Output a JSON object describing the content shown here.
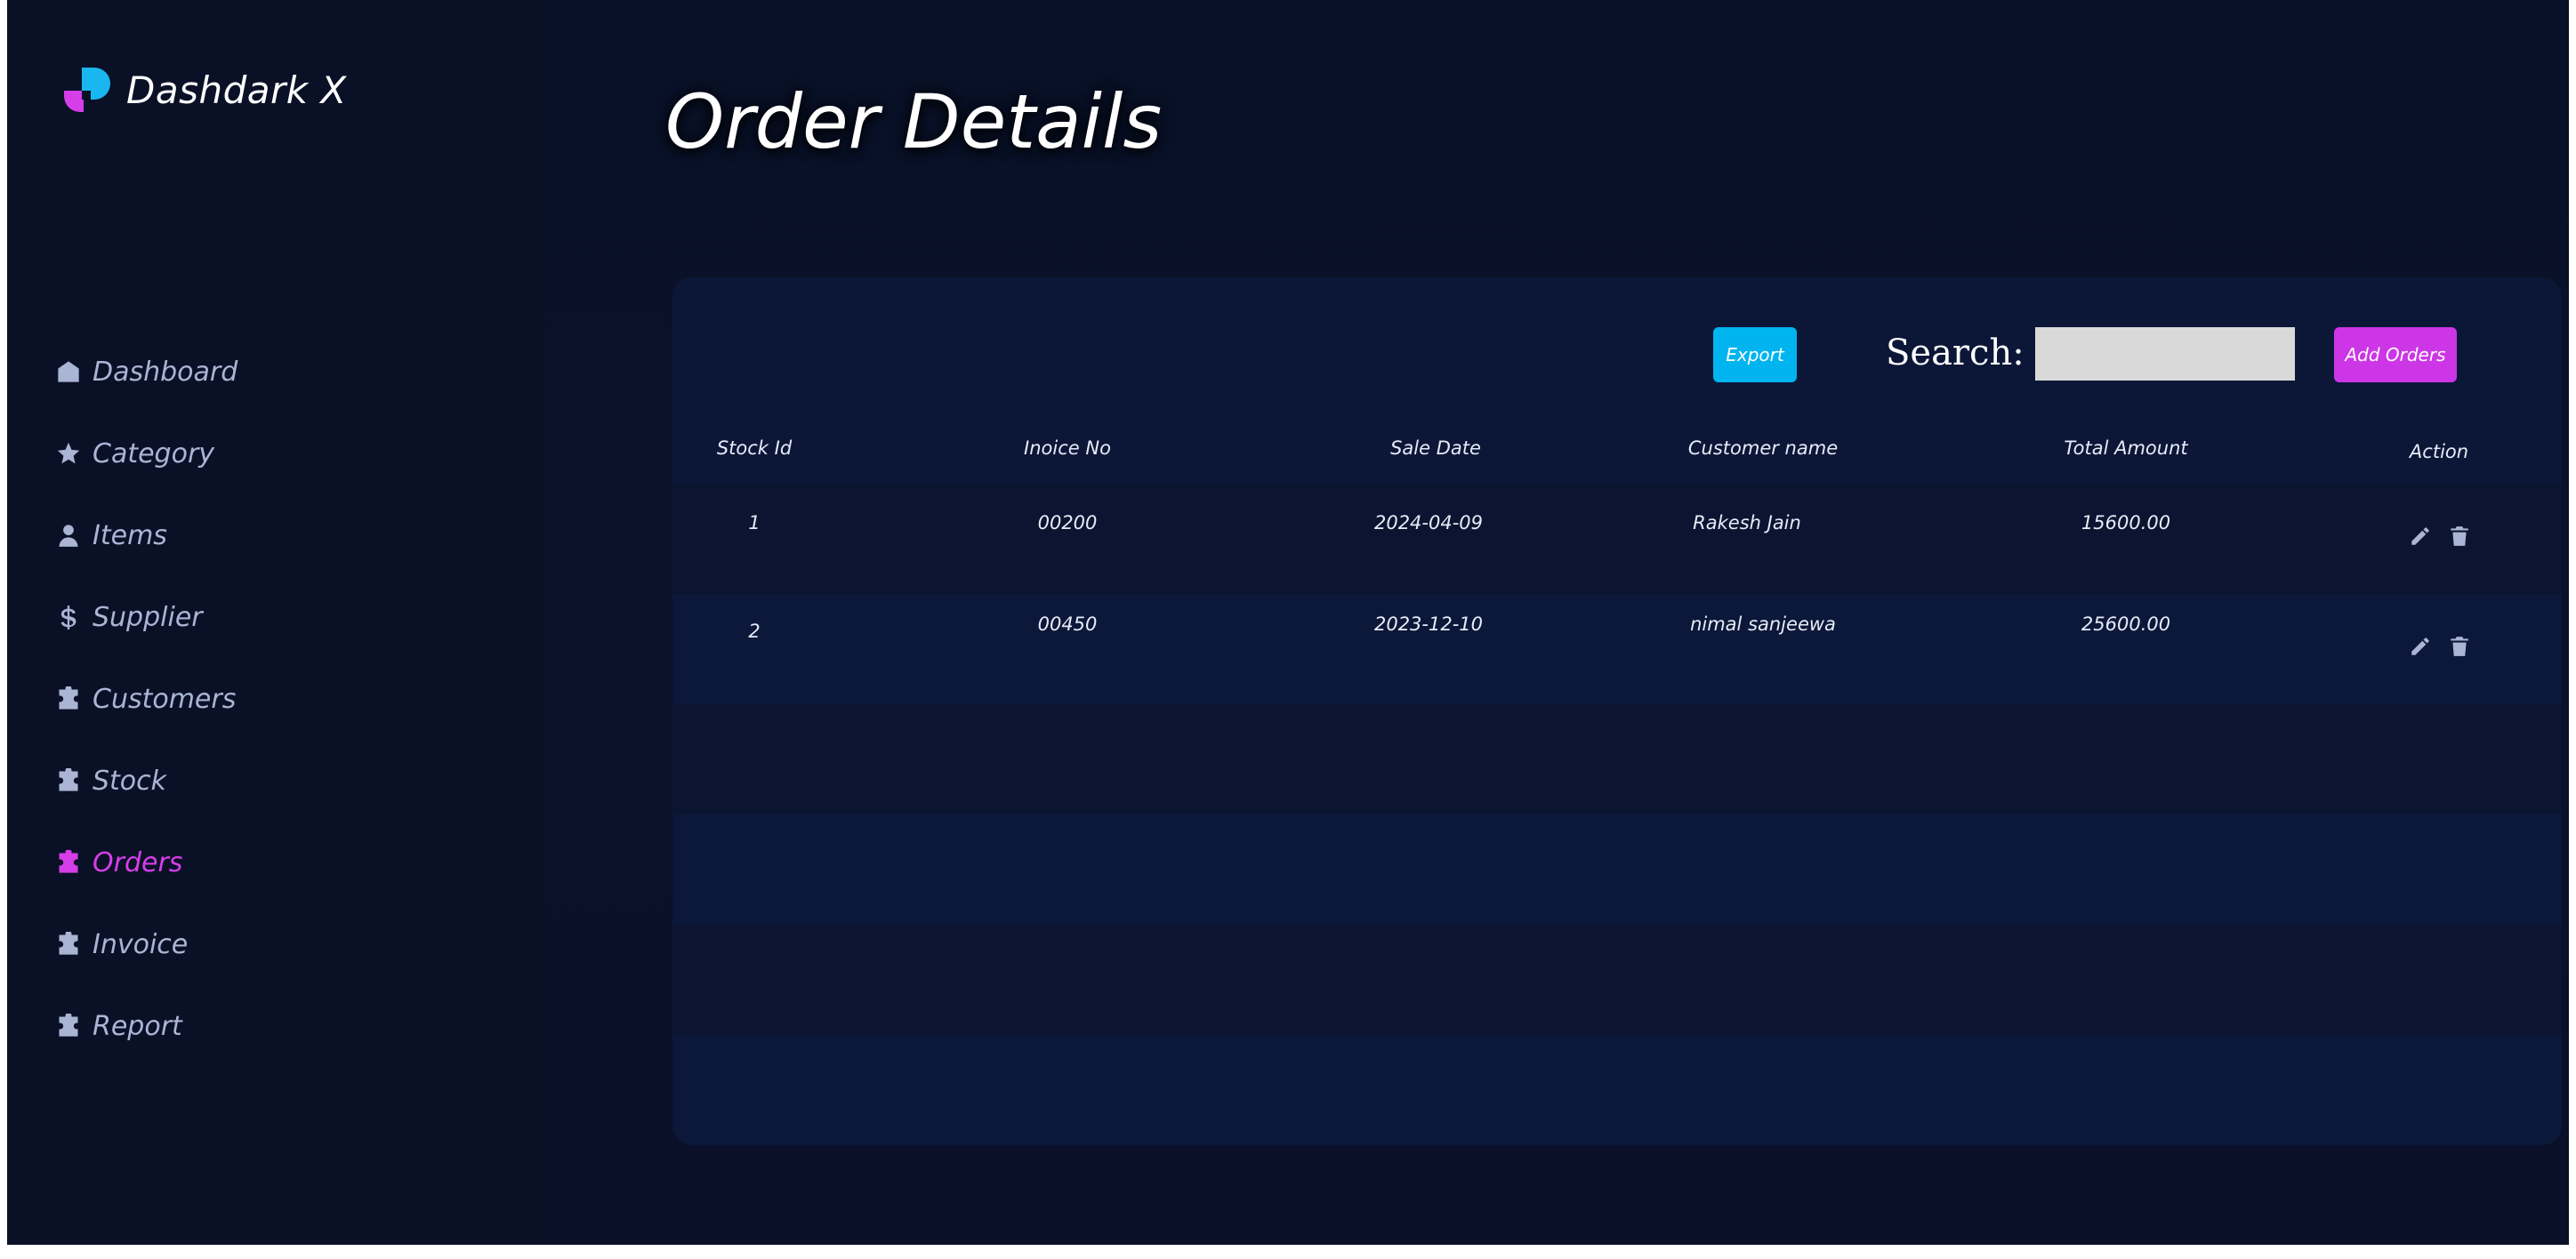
{
  "brand": {
    "name": "Dashdark X"
  },
  "sidebar": {
    "items": [
      {
        "label": "Dashboard",
        "icon": "home-icon"
      },
      {
        "label": "Category",
        "icon": "star-icon"
      },
      {
        "label": "Items",
        "icon": "user-icon"
      },
      {
        "label": "Supplier",
        "icon": "dollar-icon"
      },
      {
        "label": "Customers",
        "icon": "puzzle-icon"
      },
      {
        "label": "Stock",
        "icon": "puzzle-icon"
      },
      {
        "label": "Orders",
        "icon": "puzzle-icon",
        "active": true
      },
      {
        "label": "Invoice",
        "icon": "puzzle-icon"
      },
      {
        "label": "Report",
        "icon": "puzzle-icon"
      }
    ]
  },
  "page": {
    "title": "Order Details"
  },
  "toolbar": {
    "export_label": "Export",
    "search_label": "Search:",
    "search_value": "",
    "add_label": "Add Orders"
  },
  "table": {
    "columns": [
      "Stock Id",
      "Inoice No",
      "Sale Date",
      "Customer name",
      "Total Amount",
      "Action"
    ],
    "rows": [
      {
        "stock_id": "1",
        "invoice_no": "00200",
        "sale_date": "2024-04-09",
        "customer": "Rakesh Jain",
        "amount": "15600.00"
      },
      {
        "stock_id": "2",
        "invoice_no": "00450",
        "sale_date": "2023-12-10",
        "customer": "nimal sanjeewa",
        "amount": "25600.00"
      }
    ]
  },
  "colors": {
    "background": "#0b1228",
    "panel": "#0c1738",
    "accent_active": "#d63ee8",
    "export_button": "#00b4f0",
    "add_button": "#cd36e6",
    "nav_text": "#aab4d4"
  }
}
